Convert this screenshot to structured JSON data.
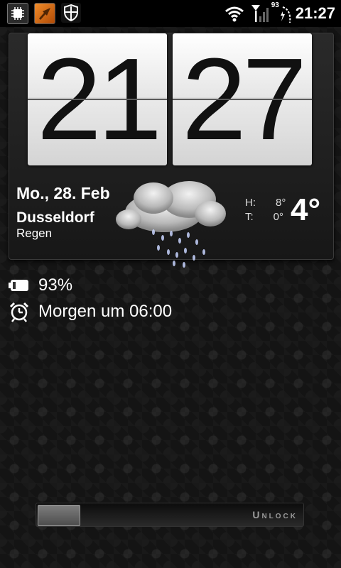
{
  "status_bar": {
    "notifications": [
      {
        "icon": "chip-icon"
      },
      {
        "icon": "launcher-icon"
      },
      {
        "icon": "shield-icon"
      }
    ],
    "battery_level": "93",
    "time": "21:27"
  },
  "clock": {
    "hours": "21",
    "minutes": "27"
  },
  "weather": {
    "date": "Mo., 28. Feb",
    "city": "Dusseldorf",
    "condition": "Regen",
    "icon": "rain-cloud-icon",
    "high_label": "H:",
    "high_value": "8°",
    "low_label": "T:",
    "low_value": "0°",
    "current_temp": "4°"
  },
  "info": {
    "battery_percent": "93%",
    "alarm": "Morgen um 06:00"
  },
  "unlock": {
    "label": "Unlock"
  }
}
